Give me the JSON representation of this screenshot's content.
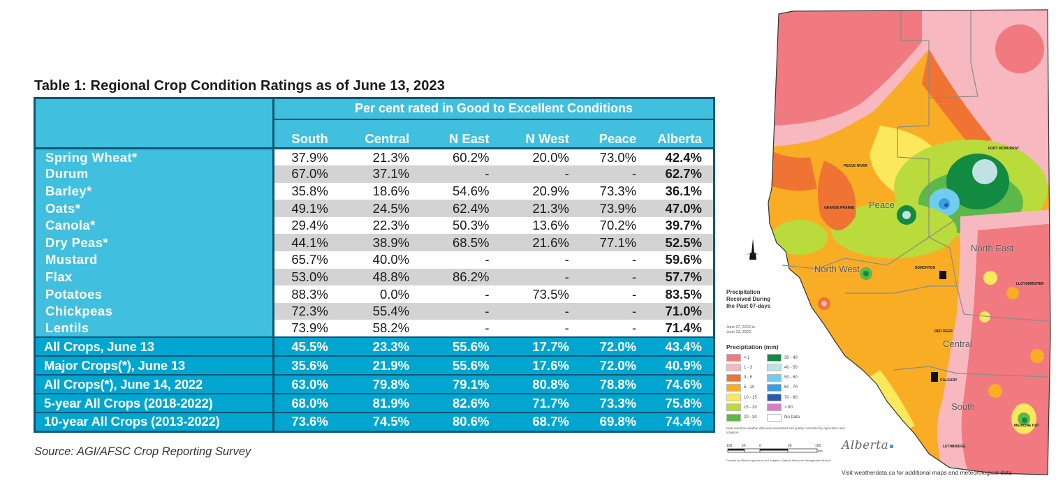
{
  "table": {
    "title": "Table 1: Regional Crop Condition Ratings as of June 13, 2023",
    "span_header": "Per cent rated in Good to Excellent Conditions",
    "columns": [
      "South",
      "Central",
      "N East",
      "N West",
      "Peace",
      "Alberta"
    ],
    "rows": [
      {
        "crop": "Spring Wheat*",
        "values": [
          "37.9%",
          "21.3%",
          "60.2%",
          "20.0%",
          "73.0%",
          "42.4%"
        ]
      },
      {
        "crop": "Durum",
        "values": [
          "67.0%",
          "37.1%",
          "-",
          "-",
          "-",
          "62.7%"
        ]
      },
      {
        "crop": "Barley*",
        "values": [
          "35.8%",
          "18.6%",
          "54.6%",
          "20.9%",
          "73.3%",
          "36.1%"
        ]
      },
      {
        "crop": "Oats*",
        "values": [
          "49.1%",
          "24.5%",
          "62.4%",
          "21.3%",
          "73.9%",
          "47.0%"
        ]
      },
      {
        "crop": "Canola*",
        "values": [
          "29.4%",
          "22.3%",
          "50.3%",
          "13.6%",
          "70.2%",
          "39.7%"
        ]
      },
      {
        "crop": "Dry Peas*",
        "values": [
          "44.1%",
          "38.9%",
          "68.5%",
          "21.6%",
          "77.1%",
          "52.5%"
        ]
      },
      {
        "crop": "Mustard",
        "values": [
          "65.7%",
          "40.0%",
          "-",
          "-",
          "-",
          "59.6%"
        ]
      },
      {
        "crop": "Flax",
        "values": [
          "53.0%",
          "48.8%",
          "86.2%",
          "-",
          "-",
          "57.7%"
        ]
      },
      {
        "crop": "Potatoes",
        "values": [
          "88.3%",
          "0.0%",
          "-",
          "73.5%",
          "-",
          "83.5%"
        ]
      },
      {
        "crop": "Chickpeas",
        "values": [
          "72.3%",
          "55.4%",
          "-",
          "-",
          "-",
          "71.0%"
        ]
      },
      {
        "crop": "Lentils",
        "values": [
          "73.9%",
          "58.2%",
          "-",
          "-",
          "-",
          "71.4%"
        ]
      }
    ],
    "summary_rows": [
      {
        "label": "All Crops, June 13",
        "values": [
          "45.5%",
          "23.3%",
          "55.6%",
          "17.7%",
          "72.0%",
          "43.4%"
        ]
      },
      {
        "label": "Major Crops(*), June 13",
        "values": [
          "35.6%",
          "21.9%",
          "55.6%",
          "17.6%",
          "72.0%",
          "40.9%"
        ]
      },
      {
        "label": "All Crops(*), June 14, 2022",
        "values": [
          "63.0%",
          "79.8%",
          "79.1%",
          "80.8%",
          "78.8%",
          "74.6%"
        ]
      },
      {
        "label": "5-year All Crops (2018-2022)",
        "values": [
          "68.0%",
          "81.9%",
          "82.6%",
          "71.7%",
          "73.3%",
          "75.8%"
        ]
      },
      {
        "label": "10-year All Crops (2013-2022)",
        "values": [
          "73.6%",
          "74.5%",
          "80.6%",
          "68.7%",
          "69.8%",
          "74.4%"
        ]
      }
    ],
    "source": "Source: AGI/AFSC Crop Reporting Survey"
  },
  "map": {
    "title_lines": [
      "Precipitation",
      "Received During",
      "the Past 07-days"
    ],
    "date_lines": [
      "June 07, 2023 to",
      "June 13, 2023"
    ],
    "legend_title": "Precipitation (mm)",
    "legend": [
      {
        "label": "< 1",
        "color": "#f07a80"
      },
      {
        "label": "30 - 40",
        "color": "#138a42"
      },
      {
        "label": "1 - 3",
        "color": "#f7b8c0"
      },
      {
        "label": "40 - 50",
        "color": "#bfe3e4"
      },
      {
        "label": "3 - 5",
        "color": "#ef7434"
      },
      {
        "label": "50 - 60",
        "color": "#6fcdef"
      },
      {
        "label": "5 - 10",
        "color": "#f8ad24"
      },
      {
        "label": "60 - 70",
        "color": "#3a9fe0"
      },
      {
        "label": "10 - 15",
        "color": "#fbe85c"
      },
      {
        "label": "70 - 80",
        "color": "#2c57b0"
      },
      {
        "label": "15 - 20",
        "color": "#b9db3c"
      },
      {
        "label": "> 80",
        "color": "#d47fc3"
      },
      {
        "label": "20 - 30",
        "color": "#5db84a"
      },
      {
        "label": "No Data",
        "color": "#ffffff"
      }
    ],
    "regions": [
      "Peace",
      "North West",
      "North East",
      "Central",
      "South"
    ],
    "cities": [
      "FORT MCMURRAY",
      "PEACE RIVER",
      "GRANDE PRAIRIE",
      "EDMONTON",
      "LLOYDMINSTER",
      "RED DEER",
      "CALGARY",
      "LETHBRIDGE",
      "MEDICINE HAT"
    ],
    "note": "Near real-time weather data was assembled and quality controlled by Agriculture and Irrigation.",
    "scale_ticks": [
      "100",
      "50",
      "0",
      "50",
      "100"
    ],
    "scale_unit": "km",
    "credit": "Created by Alberta Agriculture and Irrigation, Natural Resource Management Branch",
    "logo": "Alberta",
    "visit_note": "Visit weatherdata.ca for additional maps and meteorological data"
  }
}
